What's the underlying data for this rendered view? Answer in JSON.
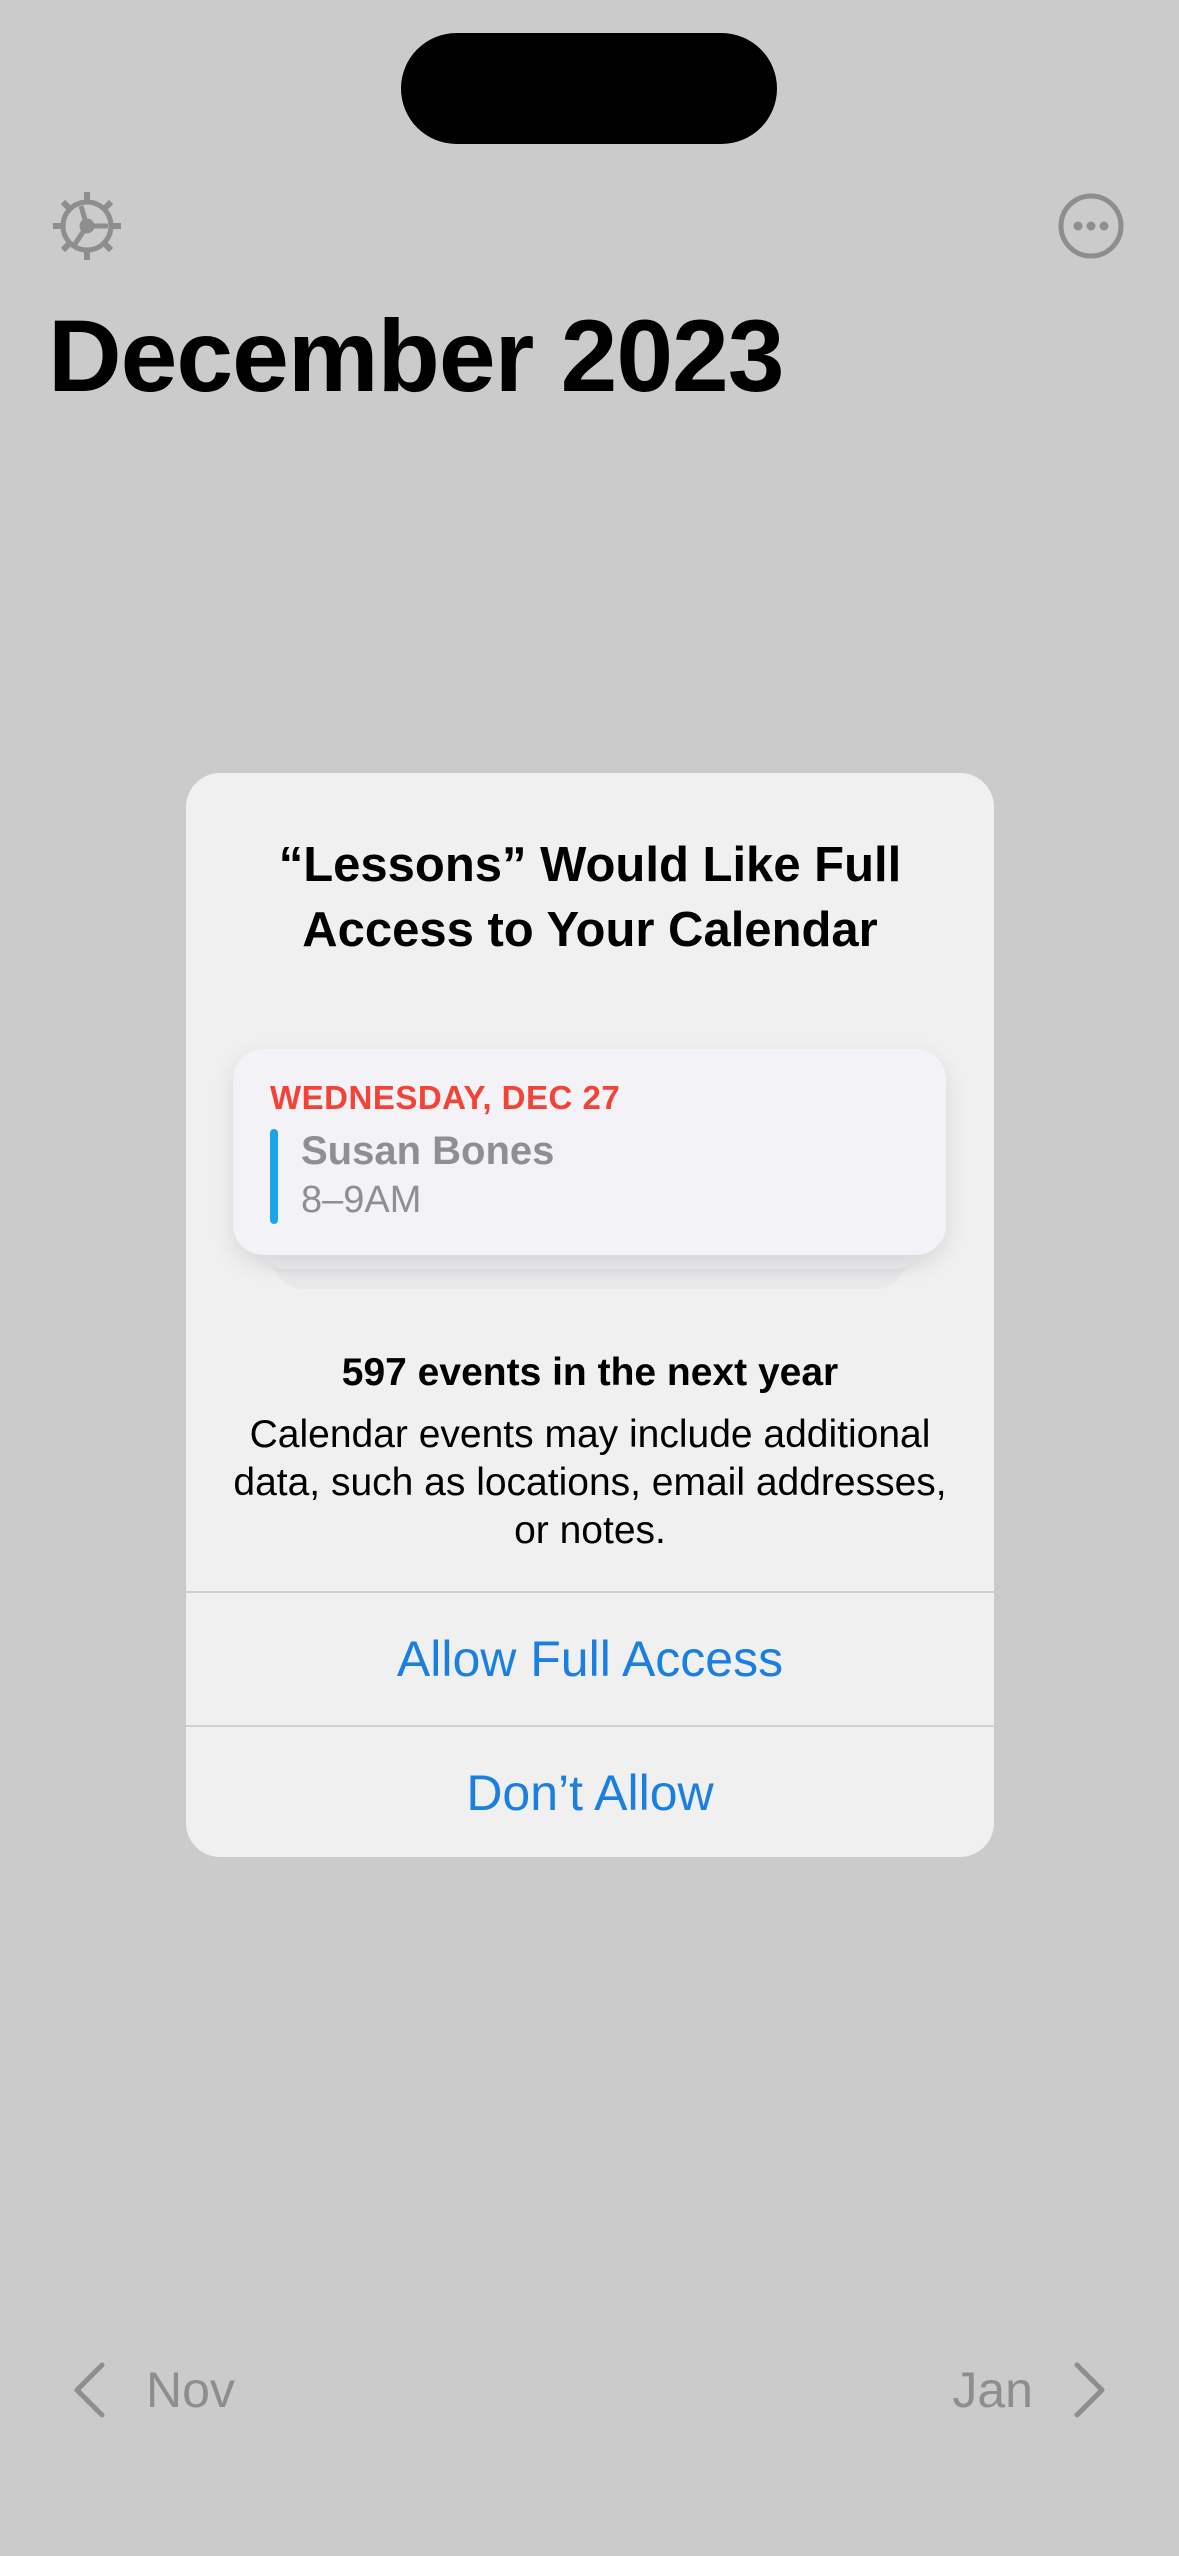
{
  "header": {
    "title": "December 2023",
    "settings_icon": "gear-icon",
    "more_icon": "ellipsis-circle-icon"
  },
  "alert": {
    "title": "“Lessons” Would Like Full Access to Your Calendar",
    "preview_event": {
      "date": "WEDNESDAY, DEC 27",
      "title": "Susan Bones",
      "time": "8–9AM",
      "bar_color": "#1aa6e8",
      "date_color": "#f44336"
    },
    "events_count": "597 events in the next year",
    "message": "Calendar events may include additional data, such as locations, email addresses, or notes.",
    "allow_label": "Allow Full Access",
    "deny_label": "Don’t Allow",
    "button_color": "#1a7fe0"
  },
  "footer": {
    "prev_label": "Nov",
    "next_label": "Jan"
  }
}
